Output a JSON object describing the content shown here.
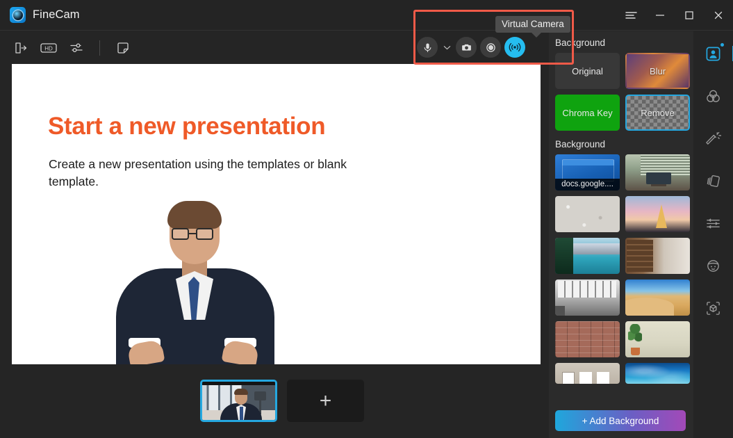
{
  "window": {
    "app_title": "FineCam",
    "controls": [
      {
        "name": "menu",
        "label": "☰"
      },
      {
        "name": "minimize",
        "label": "—"
      },
      {
        "name": "maximize",
        "label": "□"
      },
      {
        "name": "close",
        "label": "✕"
      }
    ]
  },
  "toolbar": {
    "left_icons": [
      {
        "name": "exit-icon",
        "title": "Exit"
      },
      {
        "name": "hd-icon",
        "title": "HD"
      },
      {
        "name": "settings-sliders-icon",
        "title": "Settings"
      },
      {
        "name": "sticker-icon",
        "title": "Sticker"
      }
    ],
    "capture": [
      {
        "name": "microphone-icon",
        "title": "Microphone",
        "active": false
      },
      {
        "name": "chevron-down-icon",
        "title": "Microphone options",
        "active": false
      },
      {
        "name": "snapshot-camera-icon",
        "title": "Snapshot",
        "active": false
      },
      {
        "name": "record-icon",
        "title": "Record",
        "active": false
      },
      {
        "name": "virtual-camera-icon",
        "title": "Virtual Camera",
        "active": true
      }
    ],
    "background_word": "Background",
    "tooltip": "Virtual Camera"
  },
  "preview": {
    "slide_title": "Start a new presentation",
    "slide_subtitle": "Create a new presentation using the templates or blank template.",
    "title_color": "#ef5a28"
  },
  "filmstrip": {
    "thumbnails": [
      {
        "name": "camera-source-1",
        "selected": true
      }
    ],
    "add_label": "+"
  },
  "panel": {
    "mode_heading": "Background",
    "modes": [
      {
        "label": "Original",
        "style": "original",
        "selected": false
      },
      {
        "label": "Blur",
        "style": "blur",
        "selected": false
      },
      {
        "label": "Chroma Key",
        "style": "chroma",
        "selected": false
      },
      {
        "label": "Remove",
        "style": "remove",
        "selected": true
      }
    ],
    "gallery_heading": "Background",
    "backgrounds": [
      {
        "caption": "docs.google....",
        "art": "t-docs"
      },
      {
        "caption": "",
        "art": "t-office"
      },
      {
        "caption": "",
        "art": "t-concrete"
      },
      {
        "caption": "",
        "art": "t-eiffel"
      },
      {
        "caption": "",
        "art": "t-lake"
      },
      {
        "caption": "",
        "art": "t-living"
      },
      {
        "caption": "",
        "art": "t-loft"
      },
      {
        "caption": "",
        "art": "t-desert"
      },
      {
        "caption": "",
        "art": "t-brick"
      },
      {
        "caption": "",
        "art": "t-plant"
      },
      {
        "caption": "",
        "art": "t-gallery"
      },
      {
        "caption": "",
        "art": "t-ocean"
      }
    ],
    "add_background_label": "+ Add Background"
  },
  "rail": {
    "items": [
      {
        "name": "portrait-icon",
        "active": true
      },
      {
        "name": "color-circles-icon",
        "active": false
      },
      {
        "name": "magic-wand-icon",
        "active": false
      },
      {
        "name": "layers-icon",
        "active": false
      },
      {
        "name": "adjust-sliders-icon",
        "active": false
      },
      {
        "name": "avatar-face-icon",
        "active": false
      },
      {
        "name": "3d-object-icon",
        "active": false
      }
    ],
    "accent": "#25a8e0"
  },
  "annotation": {
    "highlight_color": "#f05a48"
  }
}
